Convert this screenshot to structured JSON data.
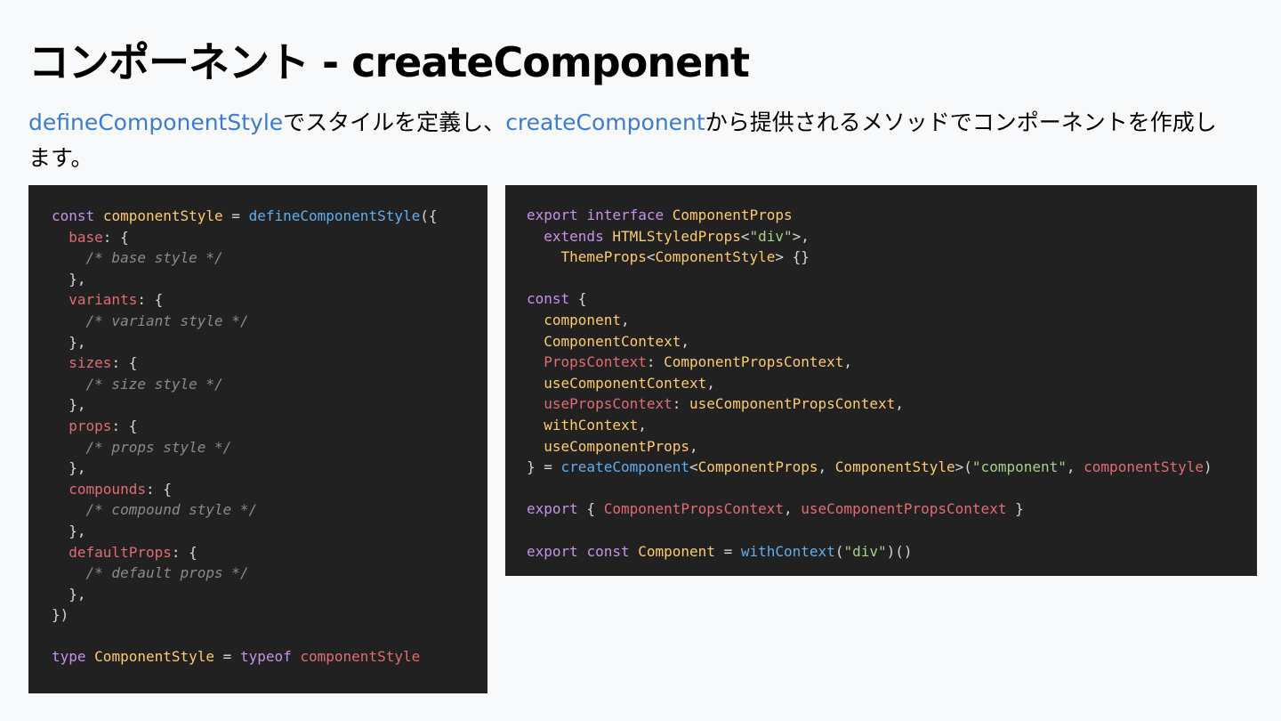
{
  "title": "コンポーネント  - createComponent",
  "description": {
    "parts": [
      {
        "text": "defineComponentStyle",
        "style": "hl"
      },
      {
        "text": "でスタイルを定義し、",
        "style": "plain"
      },
      {
        "text": "createComponent",
        "style": "hl"
      },
      {
        "text": "から提供されるメソッドでコンポーネントを作成します。",
        "style": "plain"
      }
    ]
  },
  "colors": {
    "background": "#f8f9fa",
    "code_background": "#212121",
    "link_blue": "#3d7ccc",
    "keyword": "#c792ea",
    "variable": "#ffcb6b",
    "function": "#61aeee",
    "property": "#e06c75",
    "string": "#a6d189",
    "comment": "#8b8b8b"
  },
  "code_left": [
    [
      [
        "kw",
        "const"
      ],
      [
        "txt",
        " "
      ],
      [
        "var",
        "componentStyle"
      ],
      [
        "txt",
        " = "
      ],
      [
        "fn",
        "defineComponentStyle"
      ],
      [
        "txt",
        "({"
      ]
    ],
    [
      [
        "txt",
        "  "
      ],
      [
        "prop",
        "base"
      ],
      [
        "txt",
        ": {"
      ]
    ],
    [
      [
        "txt",
        "    "
      ],
      [
        "com",
        "/* base style */"
      ]
    ],
    [
      [
        "txt",
        "  },"
      ]
    ],
    [
      [
        "txt",
        "  "
      ],
      [
        "prop",
        "variants"
      ],
      [
        "txt",
        ": {"
      ]
    ],
    [
      [
        "txt",
        "    "
      ],
      [
        "com",
        "/* variant style */"
      ]
    ],
    [
      [
        "txt",
        "  },"
      ]
    ],
    [
      [
        "txt",
        "  "
      ],
      [
        "prop",
        "sizes"
      ],
      [
        "txt",
        ": {"
      ]
    ],
    [
      [
        "txt",
        "    "
      ],
      [
        "com",
        "/* size style */"
      ]
    ],
    [
      [
        "txt",
        "  },"
      ]
    ],
    [
      [
        "txt",
        "  "
      ],
      [
        "prop",
        "props"
      ],
      [
        "txt",
        ": {"
      ]
    ],
    [
      [
        "txt",
        "    "
      ],
      [
        "com",
        "/* props style */"
      ]
    ],
    [
      [
        "txt",
        "  },"
      ]
    ],
    [
      [
        "txt",
        "  "
      ],
      [
        "prop",
        "compounds"
      ],
      [
        "txt",
        ": {"
      ]
    ],
    [
      [
        "txt",
        "    "
      ],
      [
        "com",
        "/* compound style */"
      ]
    ],
    [
      [
        "txt",
        "  },"
      ]
    ],
    [
      [
        "txt",
        "  "
      ],
      [
        "prop",
        "defaultProps"
      ],
      [
        "txt",
        ": {"
      ]
    ],
    [
      [
        "txt",
        "    "
      ],
      [
        "com",
        "/* default props */"
      ]
    ],
    [
      [
        "txt",
        "  },"
      ]
    ],
    [
      [
        "txt",
        "})"
      ]
    ],
    [],
    [
      [
        "kw",
        "type"
      ],
      [
        "txt",
        " "
      ],
      [
        "var",
        "ComponentStyle"
      ],
      [
        "txt",
        " = "
      ],
      [
        "kw",
        "typeof"
      ],
      [
        "txt",
        " "
      ],
      [
        "prop",
        "componentStyle"
      ]
    ]
  ],
  "code_right": [
    [
      [
        "kw",
        "export"
      ],
      [
        "txt",
        " "
      ],
      [
        "kw",
        "interface"
      ],
      [
        "txt",
        " "
      ],
      [
        "var",
        "ComponentProps"
      ]
    ],
    [
      [
        "txt",
        "  "
      ],
      [
        "kw",
        "extends"
      ],
      [
        "txt",
        " "
      ],
      [
        "var",
        "HTMLStyledProps"
      ],
      [
        "txt",
        "<"
      ],
      [
        "str",
        "\"div\""
      ],
      [
        "txt",
        ">,"
      ]
    ],
    [
      [
        "txt",
        "    "
      ],
      [
        "var",
        "ThemeProps"
      ],
      [
        "txt",
        "<"
      ],
      [
        "var",
        "ComponentStyle"
      ],
      [
        "txt",
        "> {}"
      ]
    ],
    [],
    [
      [
        "kw",
        "const"
      ],
      [
        "txt",
        " {"
      ]
    ],
    [
      [
        "txt",
        "  "
      ],
      [
        "var",
        "component"
      ],
      [
        "txt",
        ","
      ]
    ],
    [
      [
        "txt",
        "  "
      ],
      [
        "var",
        "ComponentContext"
      ],
      [
        "txt",
        ","
      ]
    ],
    [
      [
        "txt",
        "  "
      ],
      [
        "prop",
        "PropsContext"
      ],
      [
        "txt",
        ": "
      ],
      [
        "var",
        "ComponentPropsContext"
      ],
      [
        "txt",
        ","
      ]
    ],
    [
      [
        "txt",
        "  "
      ],
      [
        "var",
        "useComponentContext"
      ],
      [
        "txt",
        ","
      ]
    ],
    [
      [
        "txt",
        "  "
      ],
      [
        "prop",
        "usePropsContext"
      ],
      [
        "txt",
        ": "
      ],
      [
        "var",
        "useComponentPropsContext"
      ],
      [
        "txt",
        ","
      ]
    ],
    [
      [
        "txt",
        "  "
      ],
      [
        "var",
        "withContext"
      ],
      [
        "txt",
        ","
      ]
    ],
    [
      [
        "txt",
        "  "
      ],
      [
        "var",
        "useComponentProps"
      ],
      [
        "txt",
        ","
      ]
    ],
    [
      [
        "txt",
        "} = "
      ],
      [
        "fn",
        "createComponent"
      ],
      [
        "txt",
        "<"
      ],
      [
        "var",
        "ComponentProps"
      ],
      [
        "txt",
        ", "
      ],
      [
        "var",
        "ComponentStyle"
      ],
      [
        "txt",
        ">("
      ],
      [
        "str",
        "\"component\""
      ],
      [
        "txt",
        ", "
      ],
      [
        "prop",
        "componentStyle"
      ],
      [
        "txt",
        ")"
      ]
    ],
    [],
    [
      [
        "kw",
        "export"
      ],
      [
        "txt",
        " { "
      ],
      [
        "prop",
        "ComponentPropsContext"
      ],
      [
        "txt",
        ", "
      ],
      [
        "prop",
        "useComponentPropsContext"
      ],
      [
        "txt",
        " }"
      ]
    ],
    [],
    [
      [
        "kw",
        "export"
      ],
      [
        "txt",
        " "
      ],
      [
        "kw",
        "const"
      ],
      [
        "txt",
        " "
      ],
      [
        "var",
        "Component"
      ],
      [
        "txt",
        " = "
      ],
      [
        "fn",
        "withContext"
      ],
      [
        "txt",
        "("
      ],
      [
        "str",
        "\"div\""
      ],
      [
        "txt",
        ")()"
      ]
    ]
  ]
}
